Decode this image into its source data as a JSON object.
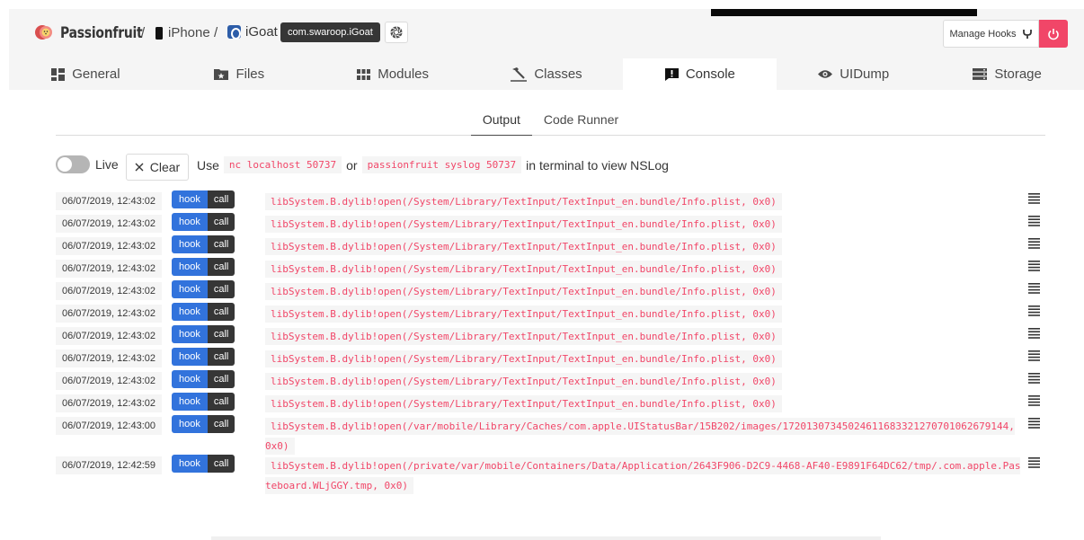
{
  "brand": {
    "name": "Passionfruit"
  },
  "breadcrumb": {
    "separator": "/",
    "device": "iPhone",
    "app": "iGoat",
    "bundle_id": "com.swaroop.iGoat"
  },
  "header": {
    "manage_hooks_label": "Manage Hooks",
    "power_color": "#f14668"
  },
  "tabs": [
    {
      "label": "General",
      "icon": "dashboard-icon"
    },
    {
      "label": "Files",
      "icon": "folder-icon"
    },
    {
      "label": "Modules",
      "icon": "grid-icon"
    },
    {
      "label": "Classes",
      "icon": "hammer-icon"
    },
    {
      "label": "Console",
      "icon": "console-icon",
      "active": true
    },
    {
      "label": "UIDump",
      "icon": "eye-icon"
    },
    {
      "label": "Storage",
      "icon": "storage-icon"
    }
  ],
  "subtabs": [
    {
      "label": "Output",
      "active": true
    },
    {
      "label": "Code Runner"
    }
  ],
  "toolbar": {
    "live_label": "Live",
    "clear_label": "Clear",
    "hint_prefix": "Use",
    "cmd1": "nc localhost 50737",
    "hint_or": "or",
    "cmd2": "passionfruit syslog 50737",
    "hint_suffix": "in terminal to view NSLog"
  },
  "log": {
    "hook_label": "hook",
    "call_label": "call",
    "entries": [
      {
        "time": "06/07/2019, 12:43:02",
        "msg": "libSystem.B.dylib!open(/System/Library/TextInput/TextInput_en.bundle/Info.plist, 0x0)"
      },
      {
        "time": "06/07/2019, 12:43:02",
        "msg": "libSystem.B.dylib!open(/System/Library/TextInput/TextInput_en.bundle/Info.plist, 0x0)"
      },
      {
        "time": "06/07/2019, 12:43:02",
        "msg": "libSystem.B.dylib!open(/System/Library/TextInput/TextInput_en.bundle/Info.plist, 0x0)"
      },
      {
        "time": "06/07/2019, 12:43:02",
        "msg": "libSystem.B.dylib!open(/System/Library/TextInput/TextInput_en.bundle/Info.plist, 0x0)"
      },
      {
        "time": "06/07/2019, 12:43:02",
        "msg": "libSystem.B.dylib!open(/System/Library/TextInput/TextInput_en.bundle/Info.plist, 0x0)"
      },
      {
        "time": "06/07/2019, 12:43:02",
        "msg": "libSystem.B.dylib!open(/System/Library/TextInput/TextInput_en.bundle/Info.plist, 0x0)"
      },
      {
        "time": "06/07/2019, 12:43:02",
        "msg": "libSystem.B.dylib!open(/System/Library/TextInput/TextInput_en.bundle/Info.plist, 0x0)"
      },
      {
        "time": "06/07/2019, 12:43:02",
        "msg": "libSystem.B.dylib!open(/System/Library/TextInput/TextInput_en.bundle/Info.plist, 0x0)"
      },
      {
        "time": "06/07/2019, 12:43:02",
        "msg": "libSystem.B.dylib!open(/System/Library/TextInput/TextInput_en.bundle/Info.plist, 0x0)"
      },
      {
        "time": "06/07/2019, 12:43:02",
        "msg": "libSystem.B.dylib!open(/System/Library/TextInput/TextInput_en.bundle/Info.plist, 0x0)"
      },
      {
        "time": "06/07/2019, 12:43:00",
        "msg": "libSystem.B.dylib!open(/var/mobile/Library/Caches/com.apple.UIStatusBar/15B202/images/1720130734502461168332127070106​2679144, 0x0)"
      },
      {
        "time": "06/07/2019, 12:42:59",
        "msg": "libSystem.B.dylib!open(/private/var/mobile/Containers/Data/Application/2643F906-D2C9-4468-AF40-E9891F64DC62/tmp/.com.a​pple.Pasteboard.WLjGGY.tmp, 0x0)"
      }
    ]
  }
}
